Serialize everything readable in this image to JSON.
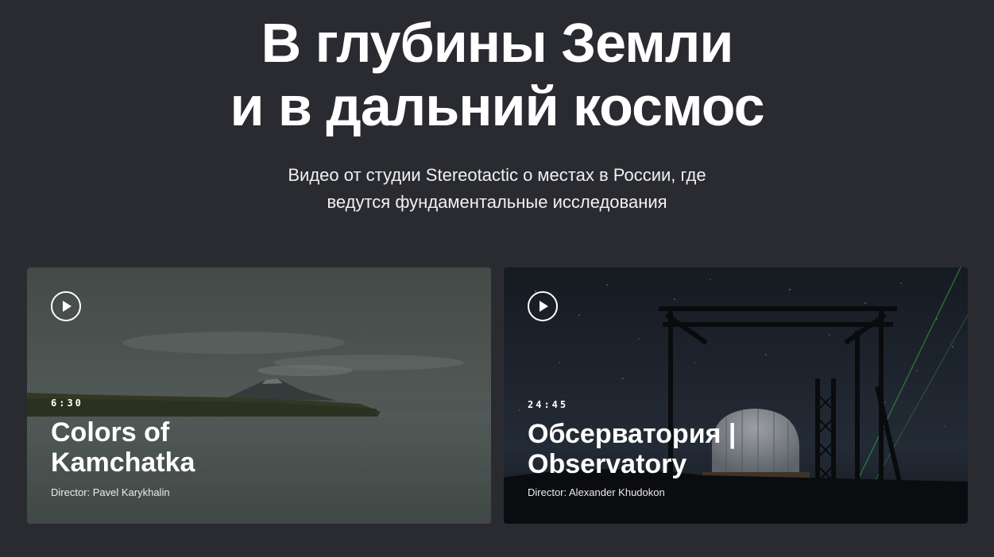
{
  "hero": {
    "title_line_1": "В глубины Земли",
    "title_line_2": "и в дальний космос",
    "subtitle_line_1": "Видео от студии Stereotactic о местах в России, где",
    "subtitle_line_2": "ведутся фундаментальные исследования"
  },
  "videos": [
    {
      "duration": "6:30",
      "title_line_1": "Colors of",
      "title_line_2": "Kamchatka",
      "director": "Director: Pavel Karykhalin",
      "play_icon": "play-icon"
    },
    {
      "duration": "24:45",
      "title_line_1": "Обсерватория |",
      "title_line_2": "Observatory",
      "director": "Director: Alexander Khudokon",
      "play_icon": "play-icon"
    }
  ],
  "colors": {
    "page_background": "#2a2b30",
    "text": "#ffffff"
  }
}
